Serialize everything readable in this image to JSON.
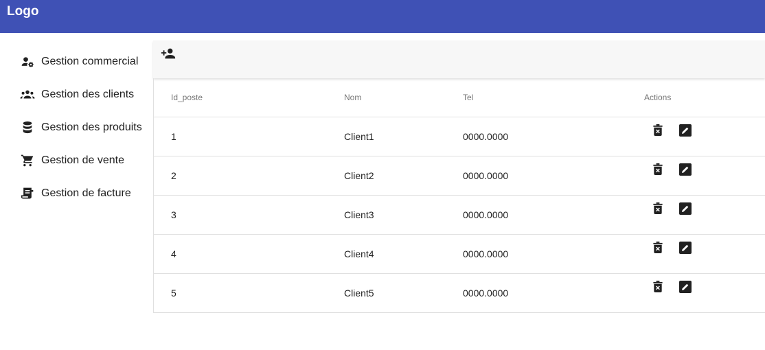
{
  "header": {
    "logo": "Logo",
    "background": "#3f51b5"
  },
  "sidebar": {
    "items": [
      {
        "label": "Gestion commercial",
        "icon": "user-settings-icon"
      },
      {
        "label": "Gestion des clients",
        "icon": "group-icon"
      },
      {
        "label": "Gestion des produits",
        "icon": "database-icon"
      },
      {
        "label": "Gestion de vente",
        "icon": "shopping-cart-icon"
      },
      {
        "label": "Gestion de facture",
        "icon": "receipt-icon"
      }
    ]
  },
  "toolbar": {
    "add_icon": "person-add-icon"
  },
  "table": {
    "headers": [
      "Id_poste",
      "Nom",
      "Tel",
      "Actions"
    ],
    "rows": [
      {
        "id": "1",
        "nom": "Client1",
        "tel": "0000.0000"
      },
      {
        "id": "2",
        "nom": "Client2",
        "tel": "0000.0000"
      },
      {
        "id": "3",
        "nom": "Client3",
        "tel": "0000.0000"
      },
      {
        "id": "4",
        "nom": "Client4",
        "tel": "0000.0000"
      },
      {
        "id": "5",
        "nom": "Client5",
        "tel": "0000.0000"
      }
    ],
    "actions": [
      "delete-forever-icon",
      "edit-icon"
    ]
  }
}
